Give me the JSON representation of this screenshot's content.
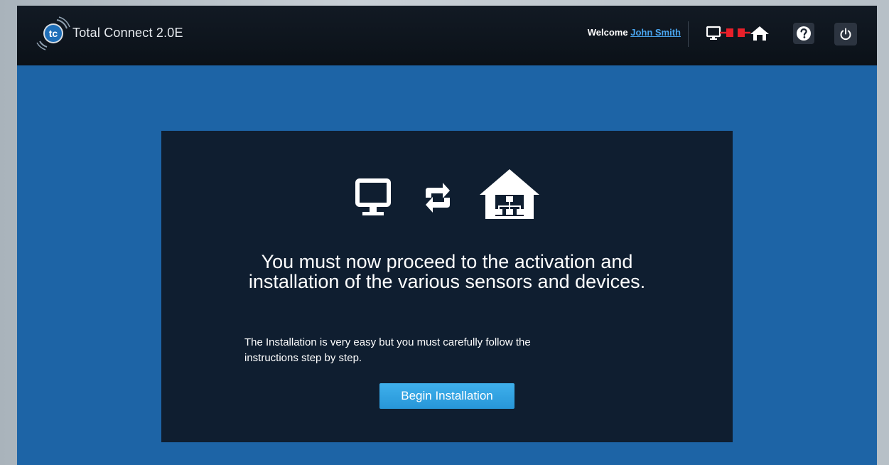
{
  "header": {
    "app_title": "Total Connect 2.0E",
    "logo_text": "tc",
    "welcome_label": "Welcome",
    "user_name": "John Smith",
    "connection_status_icon": "disconnected-link-icon",
    "connection_status_color": "#e8202a",
    "help_icon": "help-icon",
    "power_icon": "power-icon"
  },
  "panel": {
    "icons": [
      "monitor-icon",
      "sync-arrows-icon",
      "home-network-icon"
    ],
    "headline_line1": "You must now proceed to the activation and",
    "headline_line2": "installation of the various sensors and devices.",
    "instructions_line1": "The Installation is very easy but you must carefully follow the",
    "instructions_line2": "instructions step by step.",
    "begin_button_label": "Begin Installation"
  },
  "colors": {
    "header_background": "#0f161e",
    "page_background": "#1d64a6",
    "panel_background": "#0f1e30",
    "accent_button": "#2d9fe0",
    "link": "#4aa6f0"
  }
}
